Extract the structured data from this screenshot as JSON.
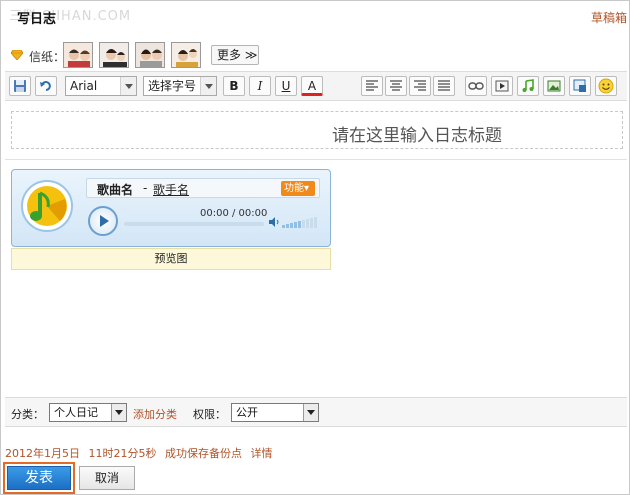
{
  "header": {
    "title": "写日志",
    "watermark": "三联 SJIHAN.COM",
    "draft_link": "草稿箱"
  },
  "paper": {
    "label": "信纸：",
    "thumbnails": [
      "paper-theme-1",
      "paper-theme-2",
      "paper-theme-3",
      "paper-theme-4"
    ],
    "more_label": "更多 ≫"
  },
  "toolbar": {
    "font": "Arial",
    "font_size": "选择字号",
    "bold": "B",
    "italic": "I",
    "underline": "U",
    "font_color": "A",
    "icons": [
      "save-icon",
      "undo-icon",
      "align-left-icon",
      "align-center-icon",
      "align-right-icon",
      "justify-icon",
      "link-icon",
      "video-icon",
      "music-icon",
      "image-icon",
      "insert-picture-icon",
      "emoticon-icon"
    ]
  },
  "editor": {
    "title_placeholder": "请在这里输入日志标题",
    "player": {
      "song_name": "歌曲名",
      "dash": "-",
      "artist": "歌手名",
      "function_button": "功能▾",
      "time": "00:00 / 00:00",
      "progress_fraction": 0.0,
      "preview_label": "预览图"
    }
  },
  "category": {
    "category_label": "分类：",
    "category_value": "个人日记",
    "add_category": "添加分类",
    "permission_label": "权限：",
    "permission_value": "公开"
  },
  "status": {
    "date": "2012年1月5日",
    "time": "11时21分5秒",
    "message": "成功保存备份点",
    "details": "详情"
  },
  "buttons": {
    "publish": "发表",
    "cancel": "取消"
  },
  "colors": {
    "accent_link": "#b0542a",
    "publish_blue": "#1c6fc4",
    "publish_border": "#e46b25",
    "player_blue": "#8ab4d9",
    "function_orange": "#f08a1a"
  }
}
